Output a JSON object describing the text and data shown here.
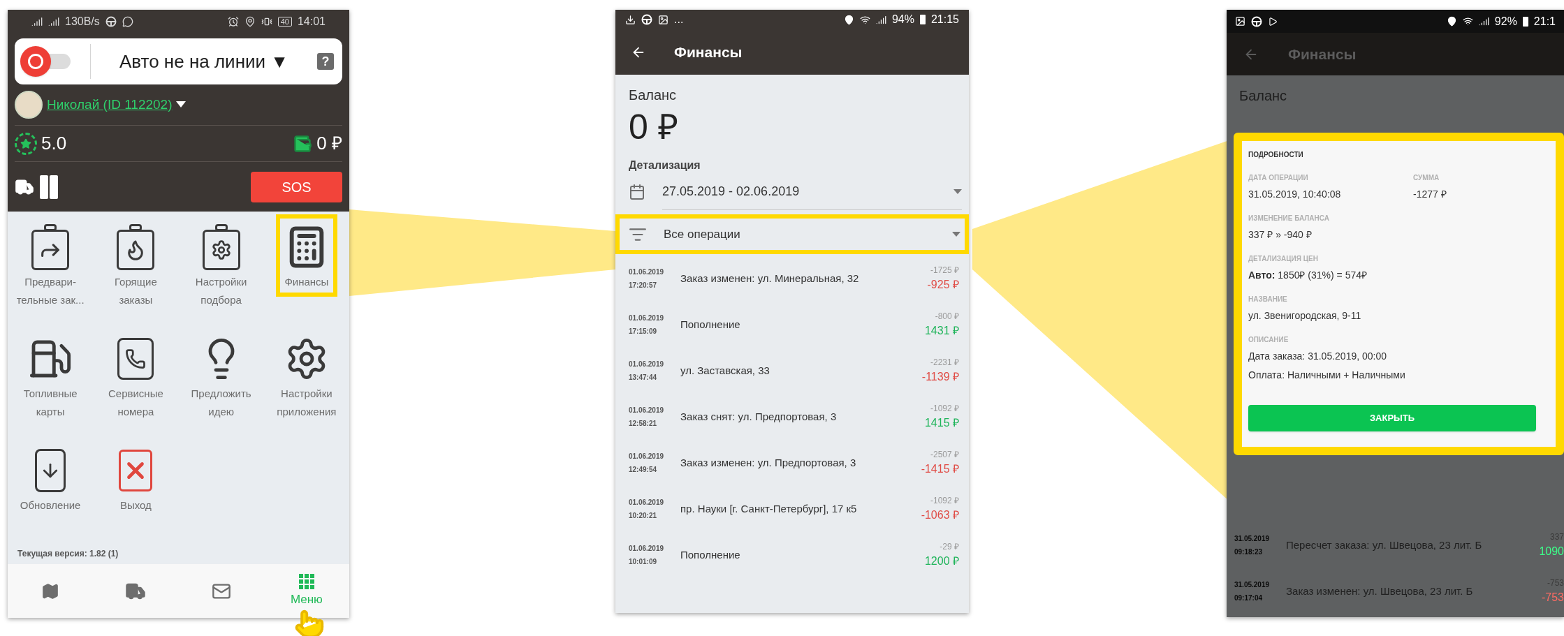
{
  "menu_screen": {
    "status_bar": {
      "speed": "130B/s",
      "battery": "40",
      "time": "14:01"
    },
    "online_toggle": {
      "on": false
    },
    "status_label": "Авто не на линии",
    "status_caret": "▼",
    "help_glyph": "?",
    "user": {
      "name": "Николай (ID 112202)"
    },
    "rating": "5.0",
    "balance": "0 ₽",
    "sos": "SOS",
    "menu_items": [
      {
        "kind": "clipboard-arrow",
        "lines": [
          "Предвари-",
          "тельные зак..."
        ],
        "highlighted": false
      },
      {
        "kind": "clipboard-fire",
        "lines": [
          "Горящие",
          "заказы"
        ],
        "highlighted": false
      },
      {
        "kind": "clipboard-gear",
        "lines": [
          "Настройки",
          "подбора"
        ],
        "highlighted": false
      },
      {
        "kind": "calculator",
        "lines": [
          "Финансы"
        ],
        "highlighted": true
      },
      {
        "kind": "fuel",
        "lines": [
          "Топливные",
          "карты"
        ],
        "highlighted": false
      },
      {
        "kind": "phone-book",
        "lines": [
          "Сервисные",
          "номера"
        ],
        "highlighted": false
      },
      {
        "kind": "bulb",
        "lines": [
          "Предложить",
          "идею"
        ],
        "highlighted": false
      },
      {
        "kind": "gear",
        "lines": [
          "Настройки",
          "приложения"
        ],
        "highlighted": false
      },
      {
        "kind": "phone-download",
        "lines": [
          "Обновление"
        ],
        "highlighted": false
      },
      {
        "kind": "exit",
        "lines": [
          "Выход"
        ],
        "highlighted": false
      }
    ],
    "version": "Текущая версия: 1.82 (1)",
    "bottom_nav": [
      {
        "kind": "map",
        "selected": false
      },
      {
        "kind": "truck",
        "selected": false
      },
      {
        "kind": "mail",
        "selected": false
      },
      {
        "kind": "grid",
        "label": "Меню",
        "selected": true
      }
    ]
  },
  "finance_screen": {
    "status_bar": {
      "more": "...",
      "battery": "94%",
      "time": "21:15"
    },
    "title": "Финансы",
    "balance_label": "Баланс",
    "balance": "0 ₽",
    "detail_label": "Детализация",
    "date_range": "27.05.2019 - 02.06.2019",
    "filter": {
      "value": "Все операции",
      "highlighted": true
    },
    "operations": [
      {
        "date": "01.06.2019",
        "time": "17:20:57",
        "title": "Заказ изменен: ул. Минеральная, 32",
        "amount": "-1725 ₽",
        "change": "-925 ₽",
        "kind": "debit"
      },
      {
        "date": "01.06.2019",
        "time": "17:15:09",
        "title": "Пополнение",
        "amount": "-800 ₽",
        "change": "1431 ₽",
        "kind": "credit"
      },
      {
        "date": "01.06.2019",
        "time": "13:47:44",
        "title": "ул. Заставская, 33",
        "amount": "-2231 ₽",
        "change": "-1139 ₽",
        "kind": "debit"
      },
      {
        "date": "01.06.2019",
        "time": "12:58:21",
        "title": "Заказ снят: ул. Предпортовая, 3",
        "amount": "-1092 ₽",
        "change": "1415 ₽",
        "kind": "credit"
      },
      {
        "date": "01.06.2019",
        "time": "12:49:54",
        "title": "Заказ изменен: ул. Предпортовая, 3",
        "amount": "-2507 ₽",
        "change": "-1415 ₽",
        "kind": "debit"
      },
      {
        "date": "01.06.2019",
        "time": "10:20:21",
        "title": "пр. Науки [г. Санкт-Петербург], 17 к5",
        "amount": "-1092 ₽",
        "change": "-1063 ₽",
        "kind": "debit"
      },
      {
        "date": "01.06.2019",
        "time": "10:01:09",
        "title": "Пополнение",
        "amount": "-29 ₽",
        "change": "1200 ₽",
        "kind": "credit"
      }
    ]
  },
  "details_screen": {
    "status_bar": {
      "battery": "92%",
      "time": "21:1"
    },
    "title": "Финансы",
    "balance_label": "Баланс",
    "dialog": {
      "highlighted": true,
      "heading": "ПОДРОБНОСТИ",
      "fields": [
        {
          "label": "ДАТА ОПЕРАЦИИ",
          "lines": [
            "31.05.2019, 10:40:08"
          ]
        },
        {
          "label": "СУММА",
          "lines": [
            "-1277 ₽"
          ]
        },
        {
          "label": "ИЗМЕНЕНИЕ БАЛАНСА",
          "lines": [
            "337 ₽ » -940 ₽"
          ]
        },
        {
          "label": "ДЕТАЛИЗАЦИЯ ЦЕН",
          "lines": [
            "**Авто:** 1850₽ (31%) = 574₽"
          ]
        },
        {
          "label": "НАЗВАНИЕ",
          "lines": [
            "ул. Звенигородская, 9-11"
          ]
        },
        {
          "label": "ОПИСАНИЕ",
          "lines": [
            "Дата заказа: 31.05.2019, 00:00",
            "Оплата:  Наличными +  Наличными"
          ]
        }
      ],
      "button": "ЗАКРЫТЬ"
    },
    "operations": [
      {
        "date": "31.05.2019",
        "time": "09:18:23",
        "title": "Пересчет заказа: ул. Швецова, 23 лит. Б",
        "amount": "337",
        "change": "1090",
        "kind": "credit"
      },
      {
        "date": "31.05.2019",
        "time": "09:17:04",
        "title": "Заказ изменен: ул. Швецова, 23 лит. Б",
        "amount": "-753",
        "change": "-753",
        "kind": "debit"
      }
    ]
  }
}
